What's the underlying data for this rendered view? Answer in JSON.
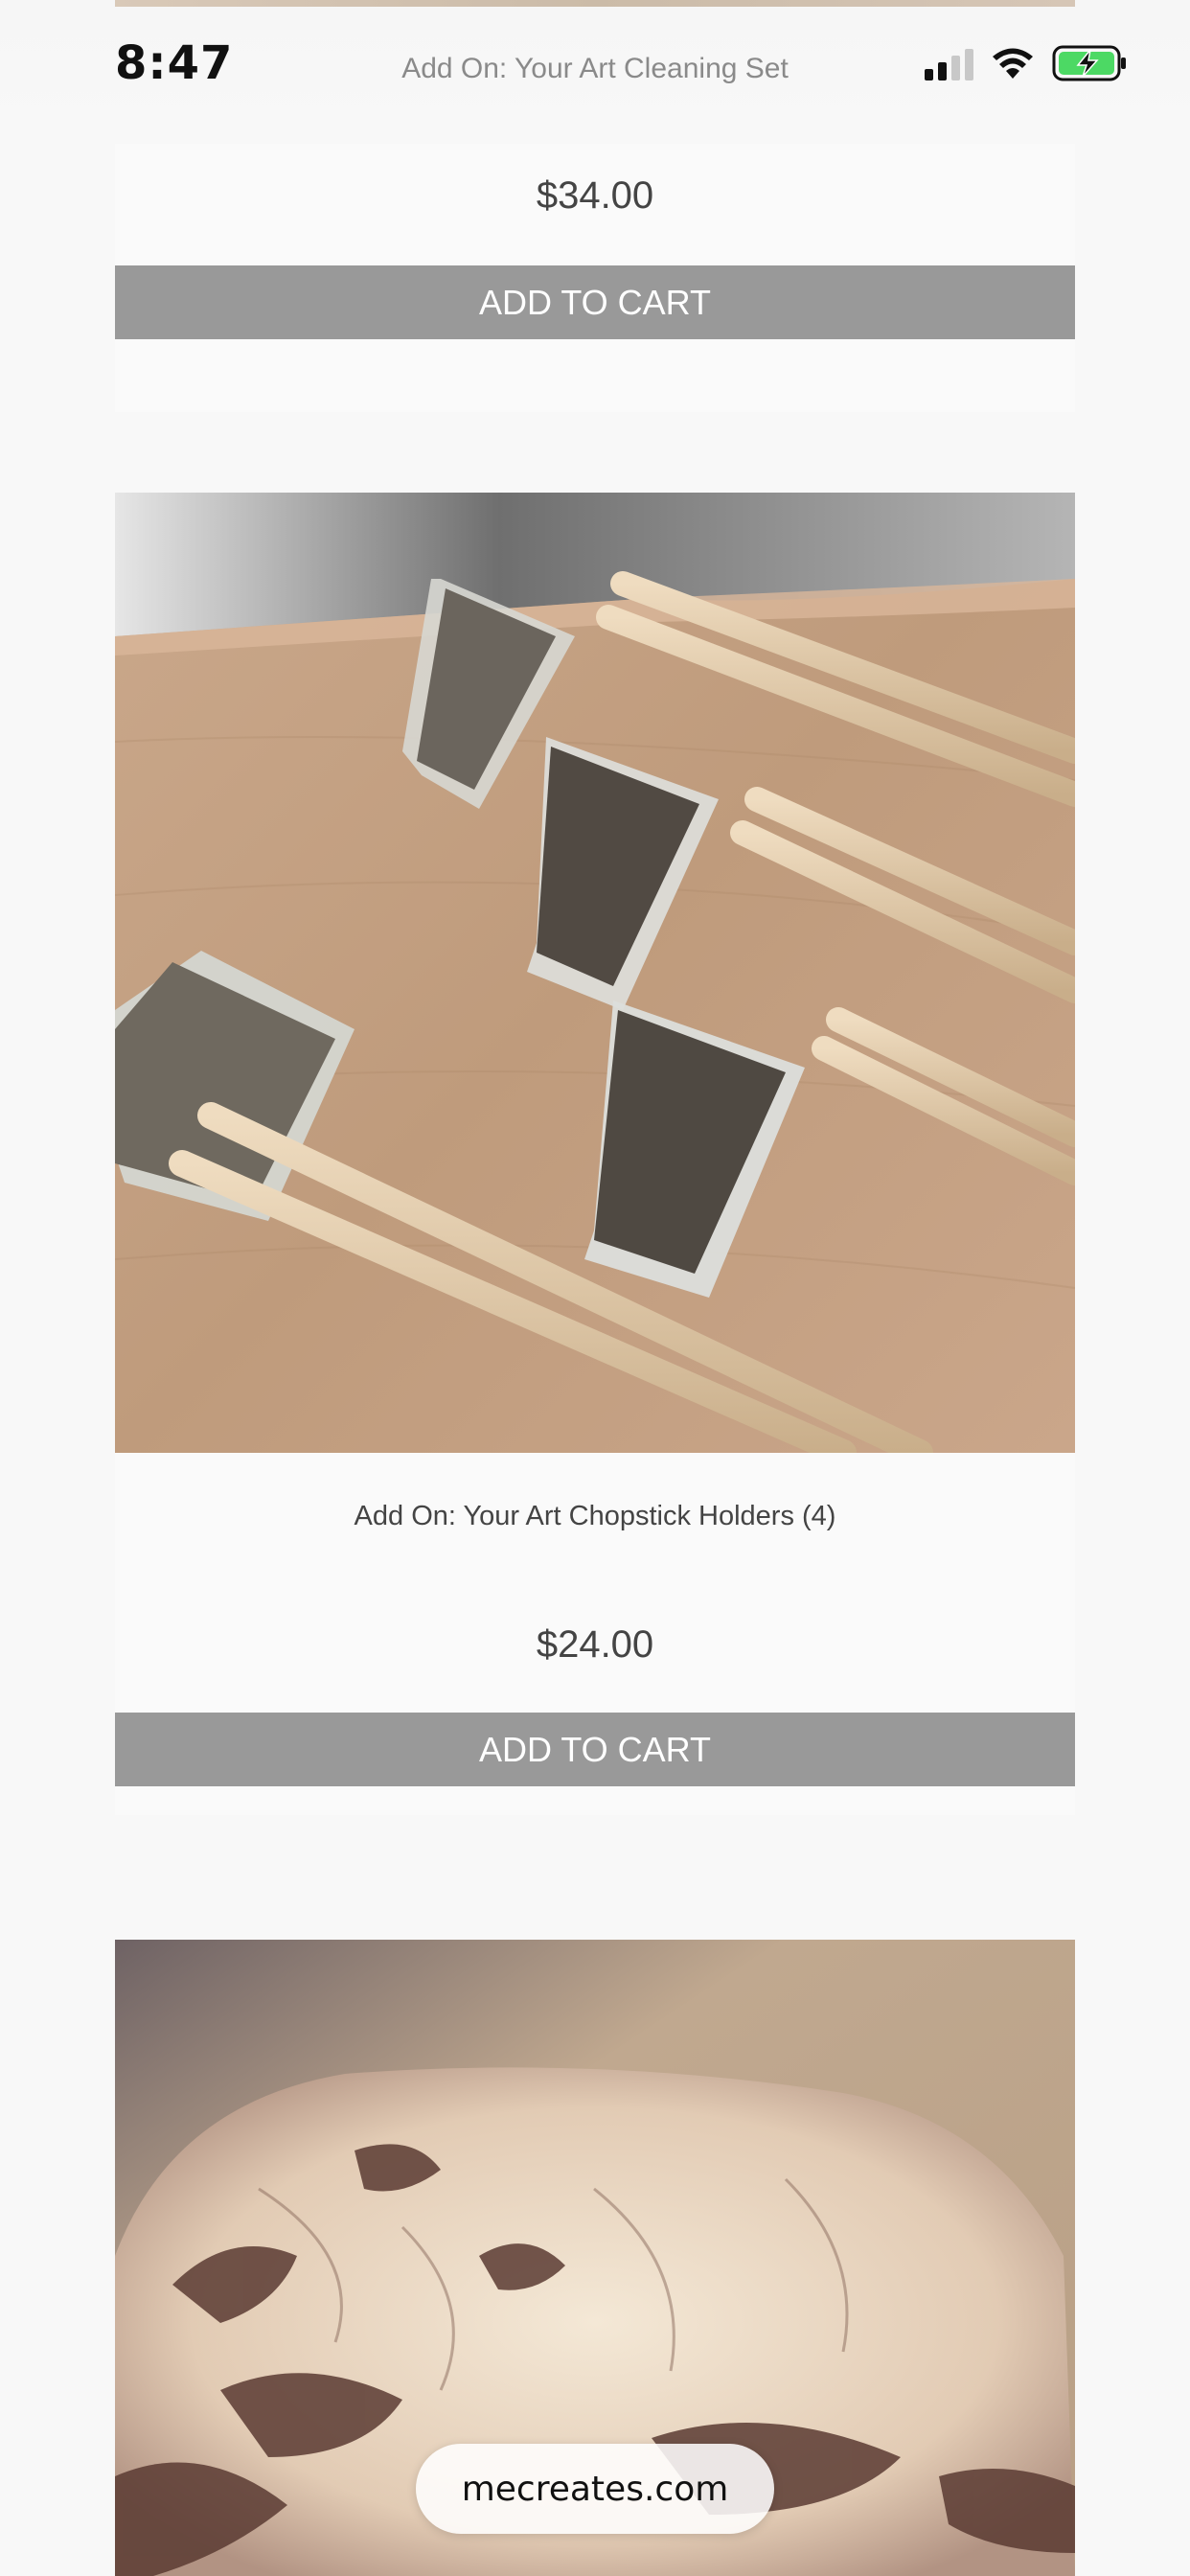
{
  "status_bar": {
    "time": "8:47",
    "page_title": "Add On: Your Art Cleaning Set",
    "battery_color": "#4cd964"
  },
  "products": [
    {
      "name": "",
      "price": "$34.00",
      "button_label": "ADD TO CART"
    },
    {
      "name": "Add On: Your Art Chopstick Holders (4)",
      "price": "$24.00",
      "button_label": "ADD TO CART",
      "image": "glass-chopstick-rests-with-chopsticks-photo"
    },
    {
      "image": "art-printed-stone-lion-photo"
    }
  ],
  "site_label": "mecreates.com",
  "colors": {
    "button_bg": "#999999",
    "button_text": "#ffffff",
    "page_bg": "#f8f8f8"
  }
}
